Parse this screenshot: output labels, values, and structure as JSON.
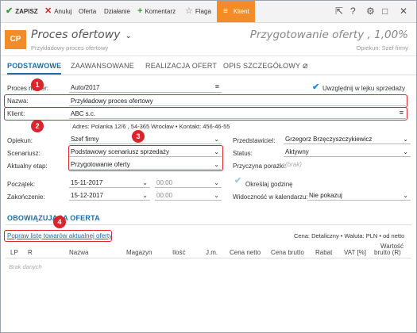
{
  "toolbar": {
    "save": "ZAPISZ",
    "cancel": "Anuluj",
    "offer": "Oferta",
    "action": "Działanie",
    "comment": "Komentarz",
    "flag": "Flaga",
    "client": "Klient"
  },
  "header": {
    "logo": "CP",
    "title": "Proces ofertowy",
    "subtitle": "Przykładowy proces ofertowy",
    "stage": "Przygotowanie oferty",
    "percent": "1,00%",
    "owner": "Opiekun: Szef firmy"
  },
  "tabs": [
    "PODSTAWOWE",
    "ZAAWANSOWANE",
    "REALIZACJA OFERT",
    "OPIS SZCZEGÓŁOWY"
  ],
  "form": {
    "process_label": "Proces numer:",
    "process_value": "Auto/2017",
    "funnel_label": "Uwzględnij w lejku sprzedaży",
    "name_label": "Nazwa:",
    "name_value": "Przykładowy proces ofertowy",
    "client_label": "Klient:",
    "client_value": "ABC s.c.",
    "address": "Adres:  Polanka  12/6 , 54-365 Wrocław  •  Kontakt:  456-46-55",
    "owner_label": "Opiekun:",
    "owner_value": "Szef firmy",
    "rep_label": "Przedstawiciel:",
    "rep_value": "Grzegorz Brzęczyszczykiewicz",
    "scenario_label": "Scenariusz:",
    "scenario_value": "Podstawowy scenariusz sprzedaży",
    "status_label": "Status:",
    "status_value": "Aktywny",
    "stage_label": "Aktualny etap:",
    "stage_value": "Przygotowanie oferty",
    "loss_label": "Przyczyna porażki:",
    "loss_value": "(brak)",
    "start_label": "Początek:",
    "start_date": "15-11-2017",
    "start_time": "00:00",
    "hour_label": "Określaj godzinę",
    "end_label": "Zakończenie:",
    "end_date": "15-12-2017",
    "end_time": "00:00",
    "calendar_label": "Widoczność w kalendarzu:",
    "calendar_value": "Nie pokazuj"
  },
  "offer": {
    "section_title": "OBOWIĄZUJĄCA OFERTA",
    "fix_link": "Popraw listę towarów aktualnej oferty",
    "price_info": "Cena: Detaliczny • Waluta: PLN • od netto",
    "columns": [
      "LP",
      "R",
      "Nazwa",
      "Magazyn",
      "Ilość",
      "J.m.",
      "Cena netto",
      "Cena brutto",
      "Rabat",
      "VAT [%]",
      "Wartość",
      "brutto (R)"
    ],
    "empty": "Brak danych"
  },
  "markers": [
    "1",
    "2",
    "3",
    "4"
  ]
}
